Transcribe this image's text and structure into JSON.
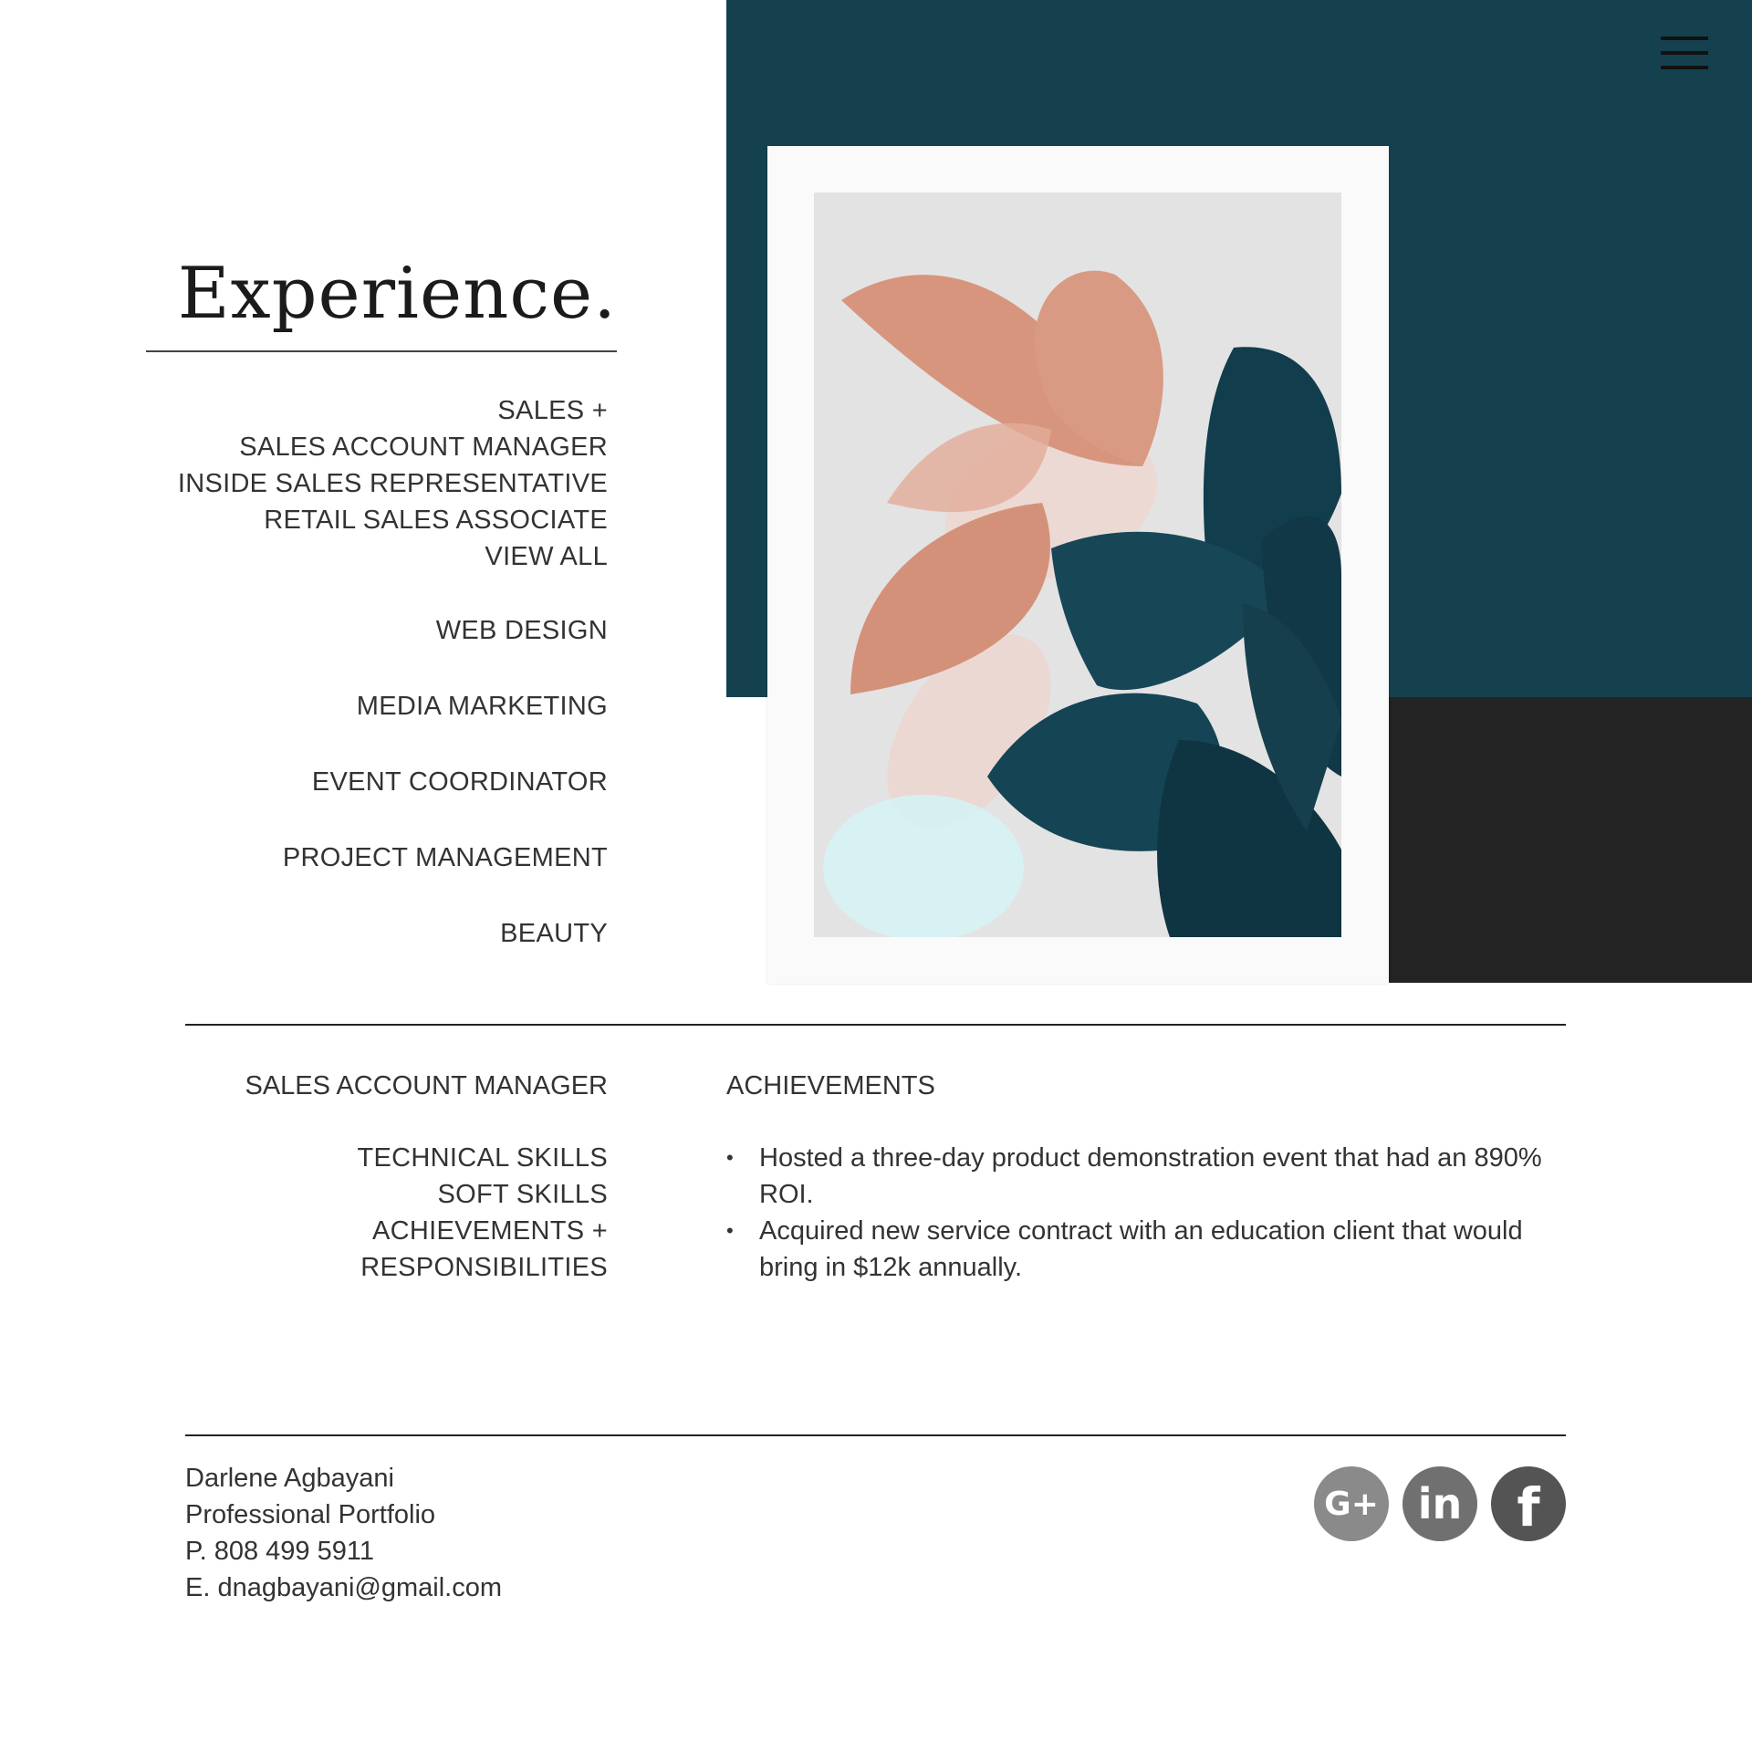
{
  "colors": {
    "teal": "#15414e",
    "dark": "#232323",
    "text": "#333333"
  },
  "heading": "Experience.",
  "nav": {
    "sales_group": [
      "SALES +",
      "SALES ACCOUNT MANAGER",
      "INSIDE SALES REPRESENTATIVE",
      "RETAIL SALES ASSOCIATE",
      "VIEW ALL"
    ],
    "web_design": "WEB DESIGN",
    "media_marketing": "MEDIA MARKETING",
    "event_coordinator": "EVENT COORDINATOR",
    "project_management": "PROJECT MANAGEMENT",
    "beauty": "BEAUTY"
  },
  "detail": {
    "title": "SALES ACCOUNT MANAGER",
    "sub_nav": [
      "TECHNICAL SKILLS",
      "SOFT SKILLS",
      "ACHIEVEMENTS +",
      "RESPONSIBILITIES"
    ],
    "achievements_heading": "ACHIEVEMENTS",
    "achievements": [
      "Hosted a three-day product demonstration event that had an 890% ROI.",
      "Acquired new service contract with an education client that would bring in  $12k annually."
    ]
  },
  "footer": {
    "name": "Darlene Agbayani",
    "subtitle": "Professional Portfolio",
    "phone": "P. 808 499 5911",
    "email": "E. dnagbayani@gmail.com"
  },
  "social": {
    "gplus": {
      "icon": "google-plus-icon",
      "glyph": "G+"
    },
    "linkedin": {
      "icon": "linkedin-icon",
      "glyph": "in"
    },
    "facebook": {
      "icon": "facebook-icon",
      "glyph": "f"
    }
  },
  "menu_icon": "hamburger-menu-icon"
}
